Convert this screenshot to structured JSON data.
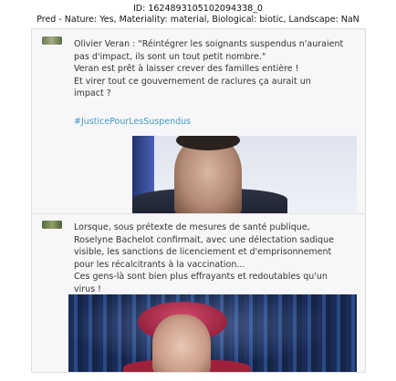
{
  "header": {
    "id_line": "ID: 1624893105102094338_0",
    "pred_line": "Pred - Nature: Yes, Materiality: material, Biological: biotic, Landscape: NaN"
  },
  "post1": {
    "text": "Olivier Veran : \"Réintégrer les soignants suspendus n'auraient\npas d'impact, ils sont un tout petit nombre.\"\nVeran est prêt à laisser crever des familles entière !\nEt virer tout ce gouvernement de raclures ça aurait un\nimpact ?",
    "hashtag": "#JusticePourLesSuspendus",
    "avatar_icon": "avatar-image"
  },
  "post2": {
    "text": "Lorsque, sous prétexte de mesures de santé publique,\nRoselyne Bachelot confirmait, avec une délectation sadique\nvisible, les sanctions de licenciement et d'emprisonnement\npour les récalcitrants à la vaccination...\nCes gens-là sont bien plus effrayants et redoutables qu'un\nvirus !",
    "avatar_icon": "avatar-image"
  },
  "colors": {
    "hashtag": "#3f9bc2",
    "card_bg": "#f7f7f9"
  }
}
